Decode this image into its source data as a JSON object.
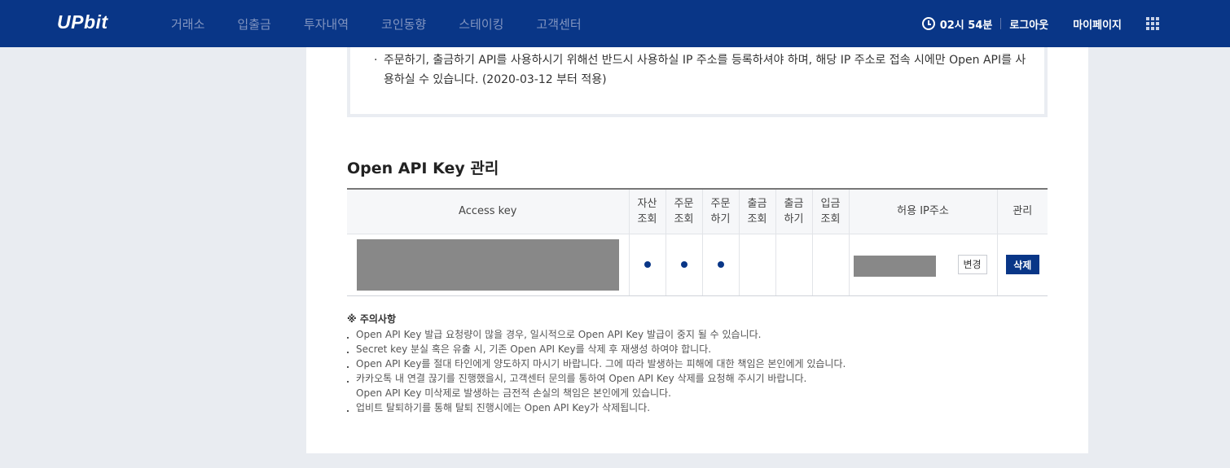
{
  "header": {
    "logo": "UPbit",
    "nav": [
      "거래소",
      "입출금",
      "투자내역",
      "코인동향",
      "스테이킹",
      "고객센터"
    ],
    "clock": "02시 54분",
    "logout": "로그아웃",
    "mypage": "마이페이지"
  },
  "notice": {
    "line1": "주문하기, 출금하기 API를 사용하시기 위해선 반드시 사용하실 IP 주소를 등록하셔야 하며, 해당 IP 주소로 접속 시에만 Open API를 사",
    "line2": "용하실 수 있습니다. (2020-03-12 부터 적용)"
  },
  "section_title": "Open API Key 관리",
  "table": {
    "headers": {
      "access_key": "Access key",
      "asset_view": [
        "자산",
        "조회"
      ],
      "order_view": [
        "주문",
        "조회"
      ],
      "order_do": [
        "주문",
        "하기"
      ],
      "withdraw_view": [
        "출금",
        "조회"
      ],
      "withdraw_do": [
        "출금",
        "하기"
      ],
      "deposit_view": [
        "입금",
        "조회"
      ],
      "ip": "허용 IP주소",
      "manage": "관리"
    },
    "row": {
      "permissions": [
        true,
        true,
        true,
        false,
        false,
        false
      ],
      "change_label": "변경",
      "delete_label": "삭제"
    }
  },
  "caution": {
    "title": "※ 주의사항",
    "items": [
      "Open API Key 발급 요청량이 많을 경우, 일시적으로 Open API Key 발급이 중지 될 수 있습니다.",
      "Secret key 분실 혹은 유출 시, 기존 Open API Key를 삭제 후 재생성 하여야 합니다.",
      "Open API Key를 절대 타인에게 양도하지 마시기 바랍니다. 그에 따라 발생하는 피해에 대한 책임은 본인에게 있습니다.",
      "카카오톡 내 연결 끊기를 진행했을시, 고객센터 문의를 통하여 Open API Key 삭제를 요청해 주시기 바랍니다.",
      "Open API Key 미삭제로 발생하는 금전적 손실의 책임은 본인에게 있습니다.",
      "업비트 탈퇴하기를 통해 탈퇴 진행시에는 Open API Key가 삭제됩니다."
    ]
  },
  "colors": {
    "brand": "#093687",
    "background": "#e9ecf1"
  }
}
